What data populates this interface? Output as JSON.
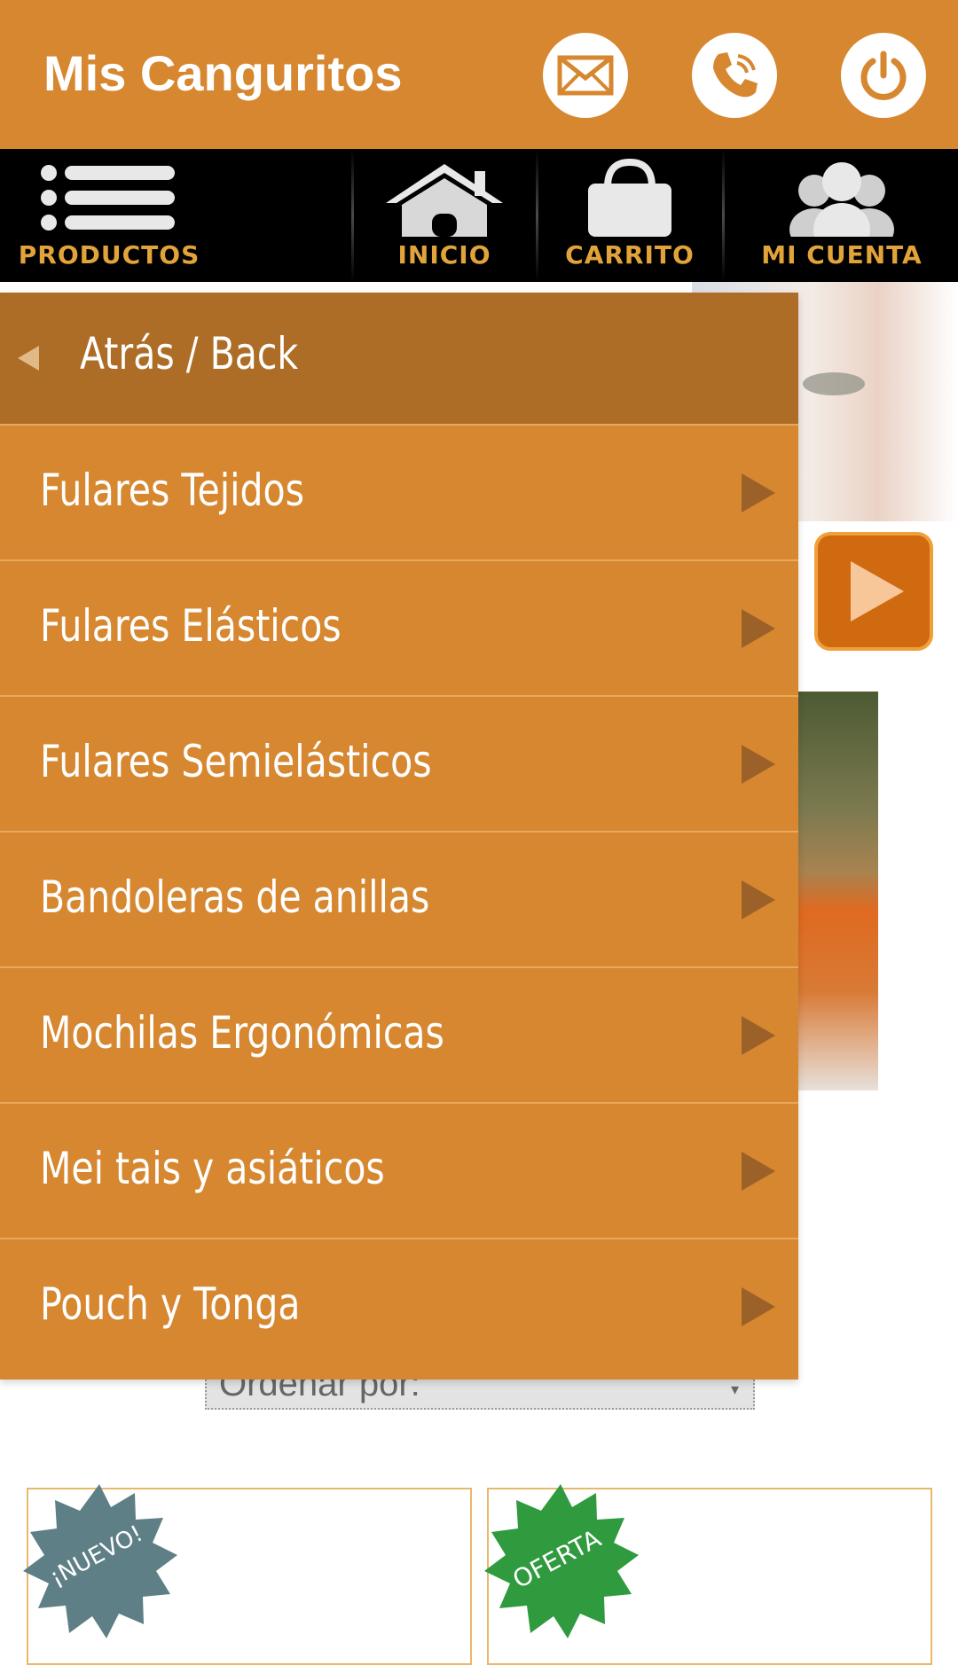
{
  "app": {
    "title": "Mis Canguritos"
  },
  "header_actions": [
    {
      "name": "email",
      "icon": "envelope-icon"
    },
    {
      "name": "phone",
      "icon": "phone-icon"
    },
    {
      "name": "power",
      "icon": "power-icon"
    }
  ],
  "nav": {
    "items": [
      {
        "label": "PRODUCTOS",
        "icon": "list-icon"
      },
      {
        "label": "INICIO",
        "icon": "home-icon"
      },
      {
        "label": "CARRITO",
        "icon": "bag-icon"
      },
      {
        "label": "MI CUENTA",
        "icon": "users-icon"
      }
    ]
  },
  "menu": {
    "back_label": "Atrás / Back",
    "items": [
      {
        "label": "Fulares Tejidos"
      },
      {
        "label": "Fulares Elásticos"
      },
      {
        "label": "Fulares Semielásticos"
      },
      {
        "label": "Bandoleras de anillas"
      },
      {
        "label": "Mochilas Ergonómicas"
      },
      {
        "label": "Mei tais y asiáticos"
      },
      {
        "label": "Pouch y Tonga"
      }
    ]
  },
  "page": {
    "sort_label": "Ordenar por:",
    "badges": [
      "¡NUEVO!",
      "OFERTA"
    ]
  },
  "colors": {
    "brand_orange": "#d6872f",
    "menu_back": "#ad6d26",
    "nav_label": "#e2a43a"
  }
}
